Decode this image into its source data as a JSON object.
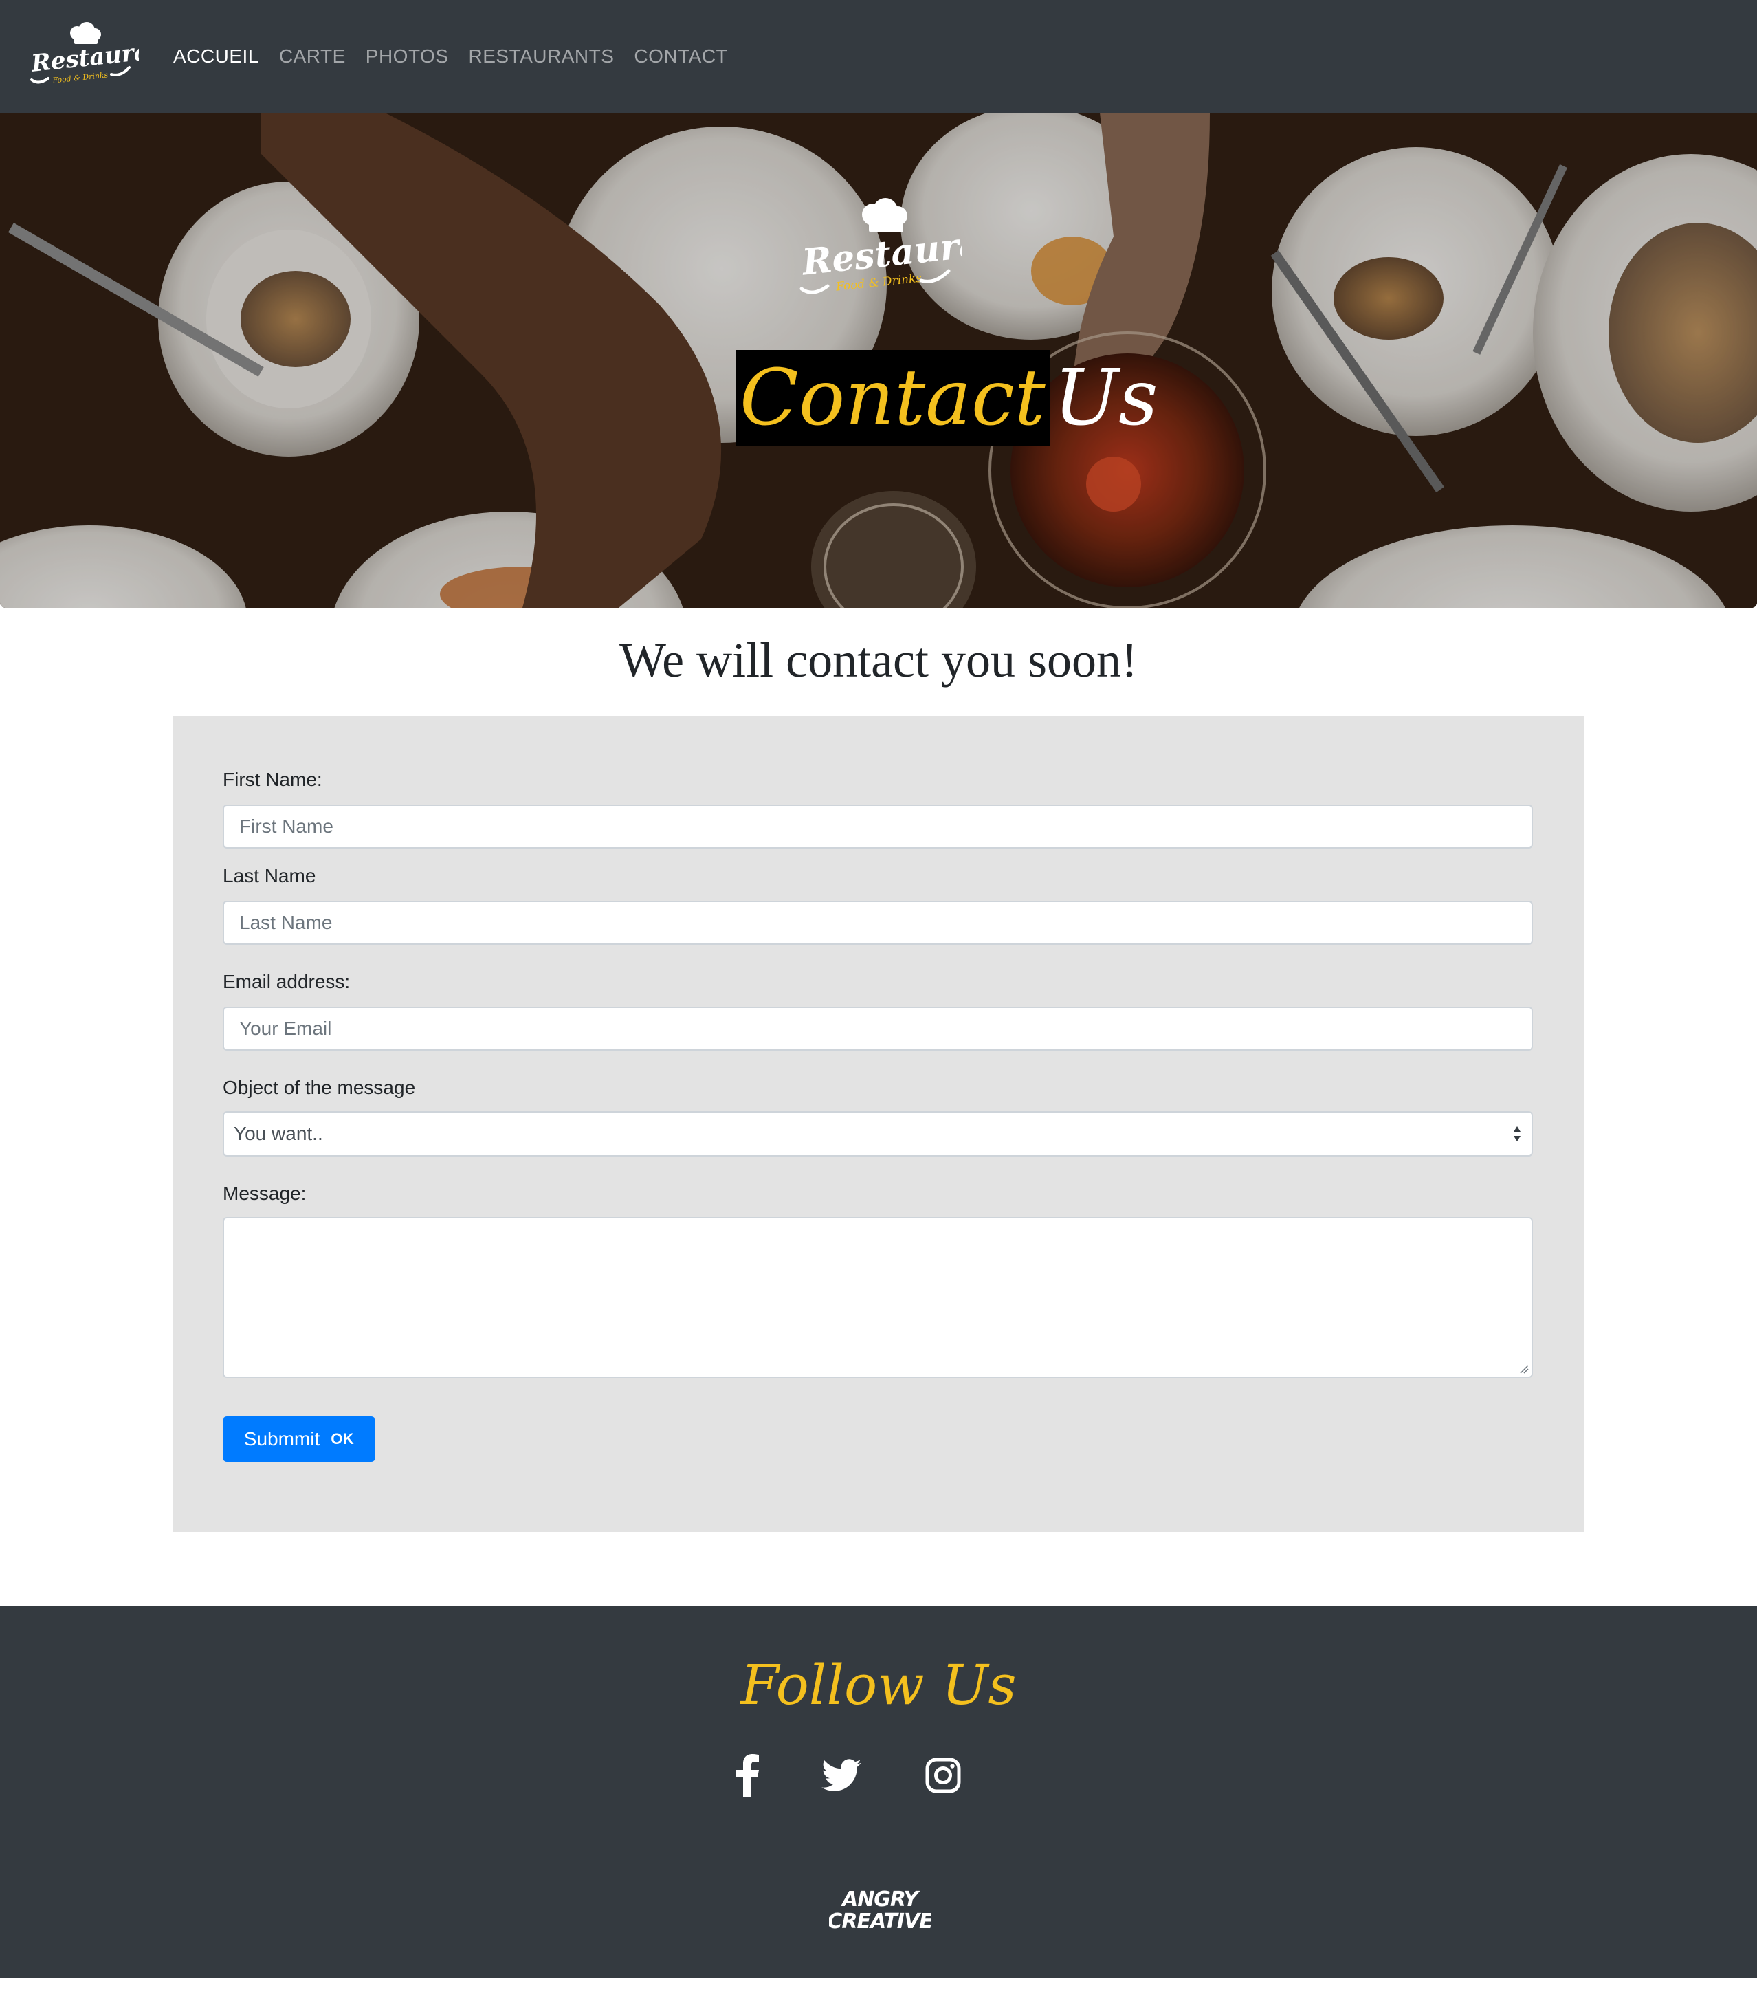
{
  "navbar": {
    "brand_logo_text": "Restaurant",
    "brand_logo_tagline": "Food & Drinks",
    "links": [
      {
        "label": "ACCUEIL",
        "active": true
      },
      {
        "label": "CARTE",
        "active": false
      },
      {
        "label": "PHOTOS",
        "active": false
      },
      {
        "label": "RESTAURANTS",
        "active": false
      },
      {
        "label": "CONTACT",
        "active": false
      }
    ]
  },
  "hero": {
    "logo_text": "Restaurant",
    "logo_tagline": "Food & Drinks",
    "title_highlight": "Contact",
    "title_rest": "Us"
  },
  "page_heading": "We will contact you soon!",
  "form": {
    "first_name_label": "First Name:",
    "first_name_placeholder": "First Name",
    "last_name_label": "Last Name",
    "last_name_placeholder": "Last Name",
    "email_label": "Email address:",
    "email_placeholder": "Your Email",
    "object_label": "Object of the message",
    "object_selected": "You want..",
    "message_label": "Message:",
    "submit_label": "Submmit",
    "submit_badge": "OK"
  },
  "footer": {
    "follow_title": "Follow Us",
    "social_icons": [
      "facebook-icon",
      "twitter-icon",
      "instagram-icon"
    ],
    "credit_logo_line1": "ANGRY",
    "credit_logo_line2": "CREATIVE"
  },
  "colors": {
    "navbar_bg": "#343a40",
    "accent_yellow": "#f4c01e",
    "primary_button": "#007bff",
    "form_bg": "#e3e3e3"
  }
}
